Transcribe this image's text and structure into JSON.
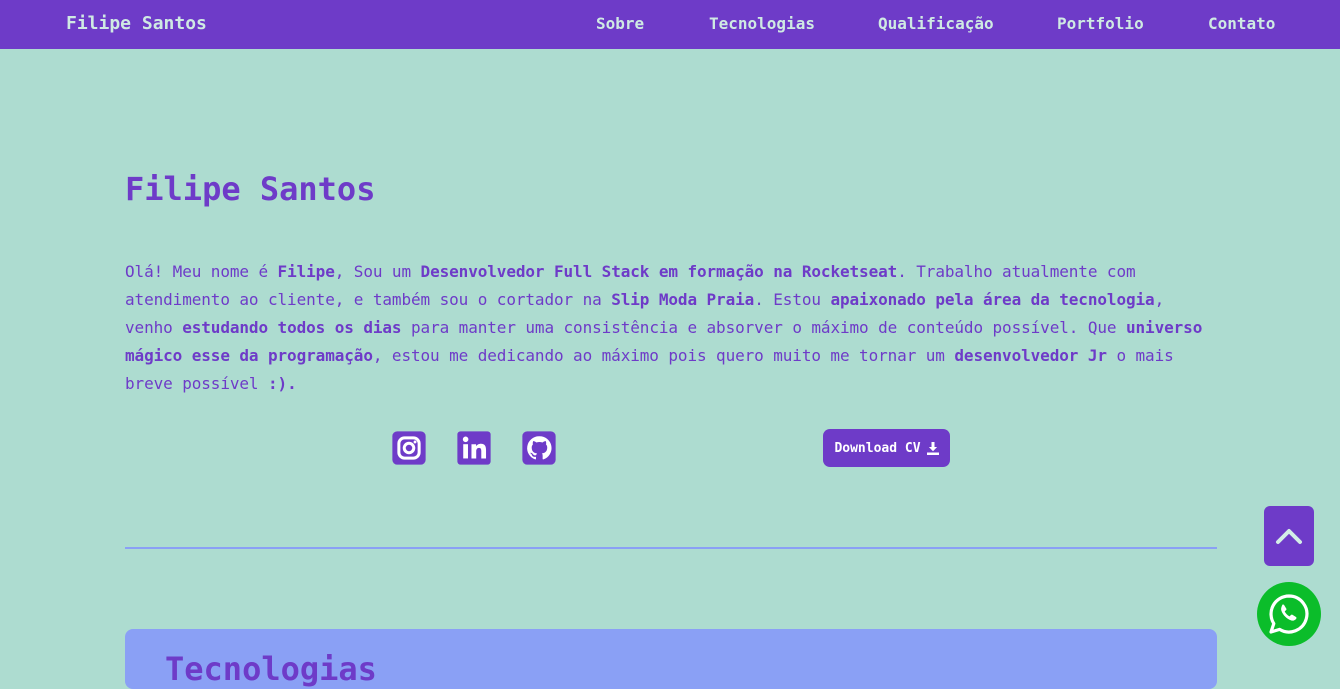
{
  "nav": {
    "brand": "Filipe Santos",
    "links": [
      "Sobre",
      "Tecnologias",
      "Qualificação",
      "Portfolio",
      "Contato"
    ]
  },
  "hero": {
    "title": "Filipe Santos",
    "bio": [
      {
        "t": "Olá! Meu nome é ",
        "b": false
      },
      {
        "t": "Filipe",
        "b": true
      },
      {
        "t": ", Sou um ",
        "b": false
      },
      {
        "t": "Desenvolvedor Full Stack em formação na Rocketseat",
        "b": true
      },
      {
        "t": ". Trabalho atualmente com atendimento ao cliente, e também sou o cortador na ",
        "b": false
      },
      {
        "t": "Slip Moda Praia",
        "b": true
      },
      {
        "t": ". Estou ",
        "b": false
      },
      {
        "t": "apaixonado pela área da tecnologia",
        "b": true
      },
      {
        "t": ", venho ",
        "b": false
      },
      {
        "t": "estudando todos os dias",
        "b": true
      },
      {
        "t": " para manter uma consistência e absorver o máximo de conteúdo possível. Que ",
        "b": false
      },
      {
        "t": "universo mágico esse da programação",
        "b": true
      },
      {
        "t": ", estou me dedicando ao máximo pois quero muito me tornar um ",
        "b": false
      },
      {
        "t": "desenvolvedor Jr",
        "b": true
      },
      {
        "t": " o mais breve possível ",
        "b": false
      },
      {
        "t": ":).",
        "b": true
      }
    ],
    "social_icons": [
      "instagram-icon",
      "linkedin-icon",
      "github-icon"
    ],
    "cv_button": "Download CV"
  },
  "tech_section": {
    "title": "Tecnologias"
  },
  "floating": {
    "scroll_top_icon": "chevron-up-icon",
    "whatsapp_icon": "whatsapp-icon"
  },
  "colors": {
    "background": "#addcd0",
    "accent": "#6e3bc8",
    "secondary": "#8aa0f5",
    "nav_text": "#cfeae3",
    "whatsapp": "#0bbd2a"
  }
}
